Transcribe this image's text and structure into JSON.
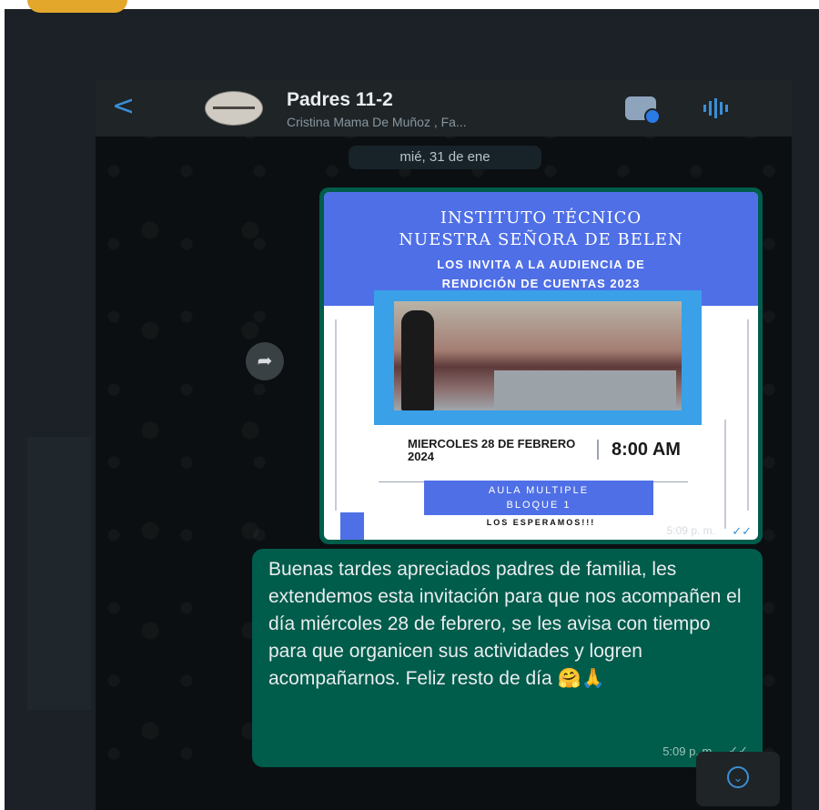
{
  "header": {
    "back_glyph": "<",
    "group_name": "Padres 11-2",
    "members_preview": "Cristina Mama De Muñoz , Fa..."
  },
  "date_separator": "mié, 31 de ene",
  "image_message": {
    "poster": {
      "line1": "INSTITUTO TÉCNICO",
      "line2": "NUESTRA SEÑORA DE BELEN",
      "line3": "LOS INVITA A LA AUDIENCIA DE",
      "line4": "RENDICIÓN DE CUENTAS 2023",
      "date": "MIERCOLES 28 DE FEBRERO 2024",
      "time": "8:00 AM",
      "place_line1": "AULA MULTIPLE",
      "place_line2": "BLOQUE 1",
      "footer": "LOS ESPERAMOS!!!"
    },
    "timestamp": "5:09 p. m."
  },
  "text_message": {
    "body": "Buenas tardes apreciados padres de familia, les extendemos esta invitación para que nos acompañen el día miércoles 28 de febrero, se les avisa con tiempo para que organicen sus actividades y logren acompañarnos. Feliz resto de día 🤗🙏",
    "timestamp": "5:09 p. m."
  },
  "icons": {
    "back": "chevron-left-icon",
    "video": "video-call-icon",
    "call": "voice-call-icon",
    "forward": "forward-icon",
    "scroll": "chevron-down-icon"
  },
  "colors": {
    "outgoing_bubble": "#005c4b",
    "accent": "#3b8fd6",
    "poster_blue": "#4f6fe6"
  }
}
